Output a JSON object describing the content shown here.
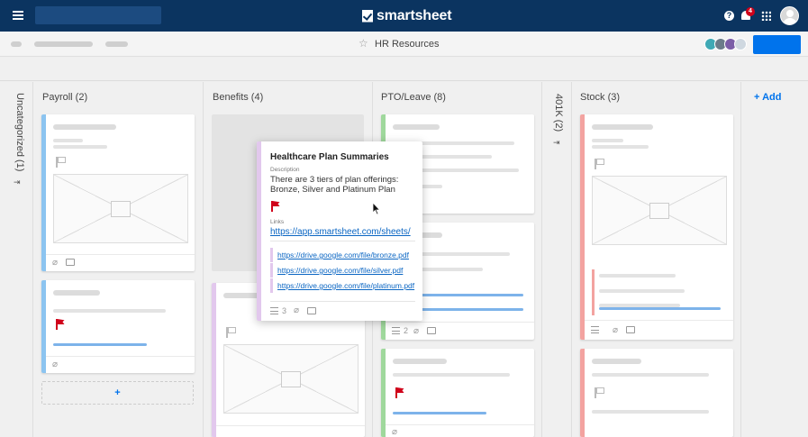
{
  "app": {
    "logo_text": "smartsheet",
    "notification_count": "4",
    "help_glyph": "?"
  },
  "sheet": {
    "title": "HR Resources"
  },
  "lanes": [
    {
      "title": "Uncategorized (1)",
      "orientation": "vertical"
    },
    {
      "title": "Payroll (2)"
    },
    {
      "title": "Benefits (4)"
    },
    {
      "title": "PTO/Leave (8)"
    },
    {
      "title": "401K (2)",
      "orientation": "vertical"
    },
    {
      "title": "Stock (3)"
    }
  ],
  "add_lane_label": "+ Add",
  "add_card_label": "+",
  "move_glyph": "⇥",
  "popup": {
    "title": "Healthcare Plan Summaries",
    "description_label": "Description",
    "description": "There are 3 tiers of plan offerings: Bronze, Silver and Platinum Plan",
    "links_label": "Links",
    "main_link": "https://app.smartsheet.com/sheets/",
    "sub_links": [
      "https://drive.google.com/file/bronze.pdf",
      "https://drive.google.com/file/silver.pdf",
      "https://drive.google.com/file/platinum.pdf"
    ],
    "checklist_count": "3"
  },
  "card_counts": {
    "pto_checklist": "2"
  },
  "colors": {
    "topbar": "#0b3460",
    "accent": "#0073ec",
    "payroll_stripe": "#8cc4f0",
    "benefits_stripe": "#e2c8ed",
    "pto_stripe": "#9fd89c",
    "stock_stripe": "#f3a3a0",
    "flag_red": "#d0021b"
  }
}
